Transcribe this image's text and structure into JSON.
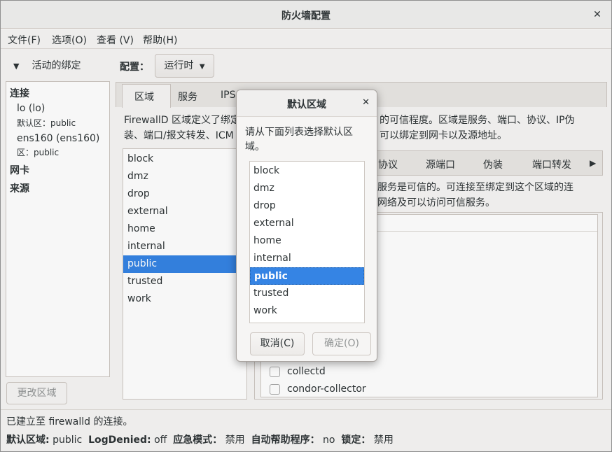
{
  "window": {
    "title": "防火墙配置"
  },
  "menu": [
    "文件(F)",
    "选项(O)",
    "查看 (V)",
    "帮助(H)"
  ],
  "bindings": {
    "header": "活动的绑定",
    "connections_label": "连接",
    "connections": [
      {
        "name": "lo (lo)",
        "zone": "默认区：public"
      },
      {
        "name": "ens160 (ens160)",
        "zone": "区：public"
      }
    ],
    "nic_label": "网卡",
    "source_label": "来源",
    "change_zone_button": "更改区域"
  },
  "config": {
    "label": "配置：",
    "mode": "运行时"
  },
  "tabs": [
    "区域",
    "服务",
    "IPS"
  ],
  "description": "FirewallD 区域定义了绑定的网络连接、接口以及源地址的可信程度。区域是服务、端口、协议、IP伪装、端口/报文转发、ICMP过滤以及富规则的组合。区域可以绑定到网卡以及源地址。",
  "description_visible": {
    "line1_left": "FirewallD 区域定义了绑定",
    "line1_right": "的可信程度。区域是服务、端口、协议、IP伪",
    "line2_left": "装、端口/报文转发、ICM",
    "line2_right": "可以绑定到网卡以及源地址。"
  },
  "zones": [
    "block",
    "dmz",
    "drop",
    "external",
    "home",
    "internal",
    "public",
    "trusted",
    "work"
  ],
  "selected_zone": "public",
  "subtabs": [
    "协议",
    "源端口",
    "伪装",
    "端口转发"
  ],
  "services_desc": {
    "line1": "些服务是可信的。可连接至绑定到这个区域的连",
    "line2": "和网络及可以访问可信服务。"
  },
  "services": [
    "collectd",
    "condor-collector"
  ],
  "status": {
    "connection": "已建立至 firewalld 的连接。",
    "default_zone_label": "默认区域:",
    "default_zone": "public",
    "log_denied_label": "LogDenied:",
    "log_denied": "off",
    "panic_label": "应急模式：",
    "panic": "禁用",
    "helper_label": "自动帮助程序：",
    "helper": "no",
    "lockdown_label": "锁定：",
    "lockdown": "禁用"
  },
  "dialog": {
    "title": "默认区域",
    "prompt": "请从下面列表选择默认区域。",
    "cancel": "取消(C)",
    "ok": "确定(O)"
  }
}
